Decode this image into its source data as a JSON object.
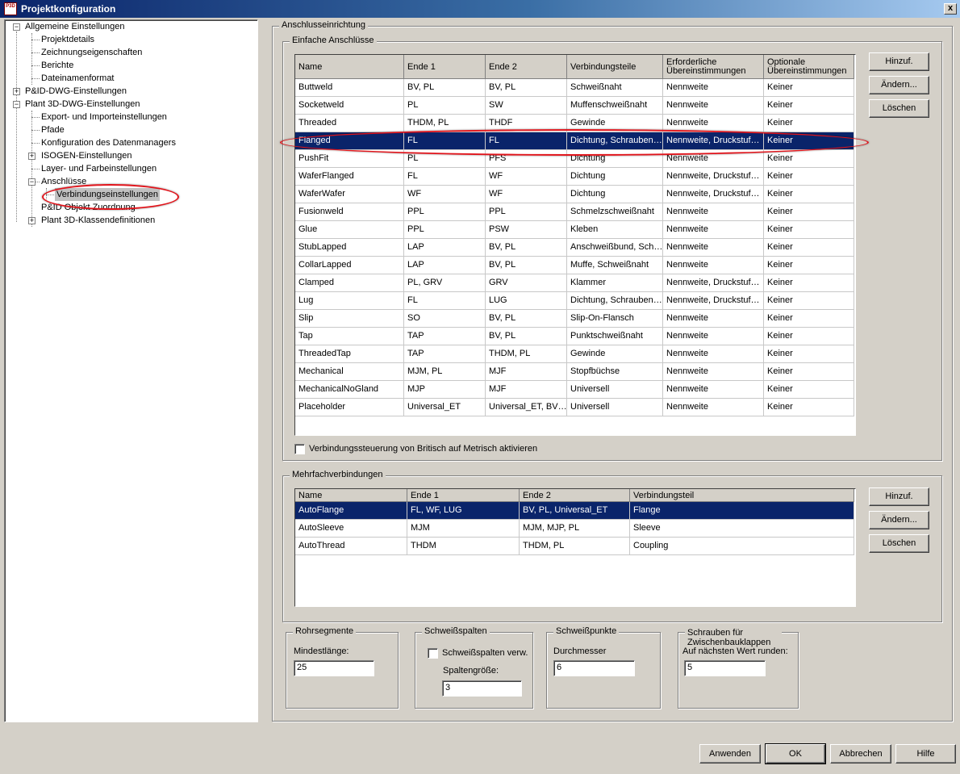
{
  "window": {
    "title": "Projektkonfiguration",
    "close": "x",
    "app_icon": "P3D"
  },
  "tree": {
    "items": [
      {
        "label": "Allgemeine Einstellungen"
      },
      {
        "label": "Projektdetails"
      },
      {
        "label": "Zeichnungseigenschaften"
      },
      {
        "label": "Berichte"
      },
      {
        "label": "Dateinamenformat"
      },
      {
        "label": "P&ID-DWG-Einstellungen"
      },
      {
        "label": "Plant 3D-DWG-Einstellungen"
      },
      {
        "label": "Export- und Importeinstellungen"
      },
      {
        "label": "Pfade"
      },
      {
        "label": "Konfiguration des Datenmanagers"
      },
      {
        "label": "ISOGEN-Einstellungen"
      },
      {
        "label": "Layer- und Farbeinstellungen"
      },
      {
        "label": "Anschlüsse"
      },
      {
        "label": "Verbindungseinstellungen"
      },
      {
        "label": "P&ID Objekt Zuordnung"
      },
      {
        "label": "Plant 3D-Klassendefinitionen"
      }
    ]
  },
  "group_main": {
    "title": "Anschlusseinrichtung"
  },
  "simple": {
    "title": "Einfache Anschlüsse",
    "headers": [
      "Name",
      "Ende 1",
      "Ende 2",
      "Verbindungsteile",
      "Erforderliche Übereinstimmungen",
      "Optionale Übereinstimmungen"
    ],
    "rows": [
      [
        "Buttweld",
        "BV, PL",
        "BV, PL",
        "Schweißnaht",
        "Nennweite",
        "Keiner"
      ],
      [
        "Socketweld",
        "PL",
        "SW",
        "Muffenschweißnaht",
        "Nennweite",
        "Keiner"
      ],
      [
        "Threaded",
        "THDM, PL",
        "THDF",
        "Gewinde",
        "Nennweite",
        "Keiner"
      ],
      [
        "Flanged",
        "FL",
        "FL",
        "Dichtung, Schrauben…",
        "Nennweite, Druckstuf…",
        "Keiner"
      ],
      [
        "PushFit",
        "PL",
        "PFS",
        "Dichtung",
        "Nennweite",
        "Keiner"
      ],
      [
        "WaferFlanged",
        "FL",
        "WF",
        "Dichtung",
        "Nennweite, Druckstuf…",
        "Keiner"
      ],
      [
        "WaferWafer",
        "WF",
        "WF",
        "Dichtung",
        "Nennweite, Druckstuf…",
        "Keiner"
      ],
      [
        "Fusionweld",
        "PPL",
        "PPL",
        "Schmelzschweißnaht",
        "Nennweite",
        "Keiner"
      ],
      [
        "Glue",
        "PPL",
        "PSW",
        "Kleben",
        "Nennweite",
        "Keiner"
      ],
      [
        "StubLapped",
        "LAP",
        "BV, PL",
        "Anschweißbund, Sch…",
        "Nennweite",
        "Keiner"
      ],
      [
        "CollarLapped",
        "LAP",
        "BV, PL",
        "Muffe, Schweißnaht",
        "Nennweite",
        "Keiner"
      ],
      [
        "Clamped",
        "PL, GRV",
        "GRV",
        "Klammer",
        "Nennweite, Druckstuf…",
        "Keiner"
      ],
      [
        "Lug",
        "FL",
        "LUG",
        "Dichtung, Schrauben…",
        "Nennweite, Druckstuf…",
        "Keiner"
      ],
      [
        "Slip",
        "SO",
        "BV, PL",
        "Slip-On-Flansch",
        "Nennweite",
        "Keiner"
      ],
      [
        "Tap",
        "TAP",
        "BV, PL",
        "Punktschweißnaht",
        "Nennweite",
        "Keiner"
      ],
      [
        "ThreadedTap",
        "TAP",
        "THDM, PL",
        "Gewinde",
        "Nennweite",
        "Keiner"
      ],
      [
        "Mechanical",
        "MJM, PL",
        "MJF",
        "Stopfbüchse",
        "Nennweite",
        "Keiner"
      ],
      [
        "MechanicalNoGland",
        "MJP",
        "MJF",
        "Universell",
        "Nennweite",
        "Keiner"
      ],
      [
        "Placeholder",
        "Universal_ET",
        "Universal_ET, BV…",
        "Universell",
        "Nennweite",
        "Keiner"
      ]
    ],
    "selected_row": 3,
    "btn_add": "Hinzuf.",
    "btn_edit": "Ändern...",
    "btn_delete": "Löschen",
    "checkbox_label": "Verbindungssteuerung von Britisch auf Metrisch aktivieren"
  },
  "multi": {
    "title": "Mehrfachverbindungen",
    "headers": [
      "Name",
      "Ende 1",
      "Ende 2",
      "Verbindungsteil"
    ],
    "rows": [
      [
        "AutoFlange",
        "FL, WF, LUG",
        "BV, PL, Universal_ET",
        "Flange"
      ],
      [
        "AutoSleeve",
        "MJM",
        "MJM, MJP, PL",
        "Sleeve"
      ],
      [
        "AutoThread",
        "THDM",
        "THDM, PL",
        "Coupling"
      ]
    ],
    "selected_row": 0,
    "btn_add": "Hinzuf.",
    "btn_edit": "Ändern...",
    "btn_delete": "Löschen"
  },
  "pipe": {
    "title": "Rohrsegmente",
    "label": "Mindestlänge:",
    "value": "25"
  },
  "gap": {
    "title": "Schweißspalten",
    "checkbox_label": "Schweißspalten verw.",
    "label": "Spaltengröße:",
    "value": "3"
  },
  "point": {
    "title": "Schweißpunkte",
    "label": "Durchmesser",
    "value": "6"
  },
  "bolts": {
    "title": "Schrauben für Zwischenbauklappen",
    "label": "Auf nächsten Wert runden:",
    "value": "5"
  },
  "footer": {
    "apply": "Anwenden",
    "ok": "OK",
    "cancel": "Abbrechen",
    "help": "Hilfe"
  },
  "colors": {
    "selection": "#0a246a",
    "annotation": "#e0141b",
    "dialog": "#d4d0c8"
  }
}
